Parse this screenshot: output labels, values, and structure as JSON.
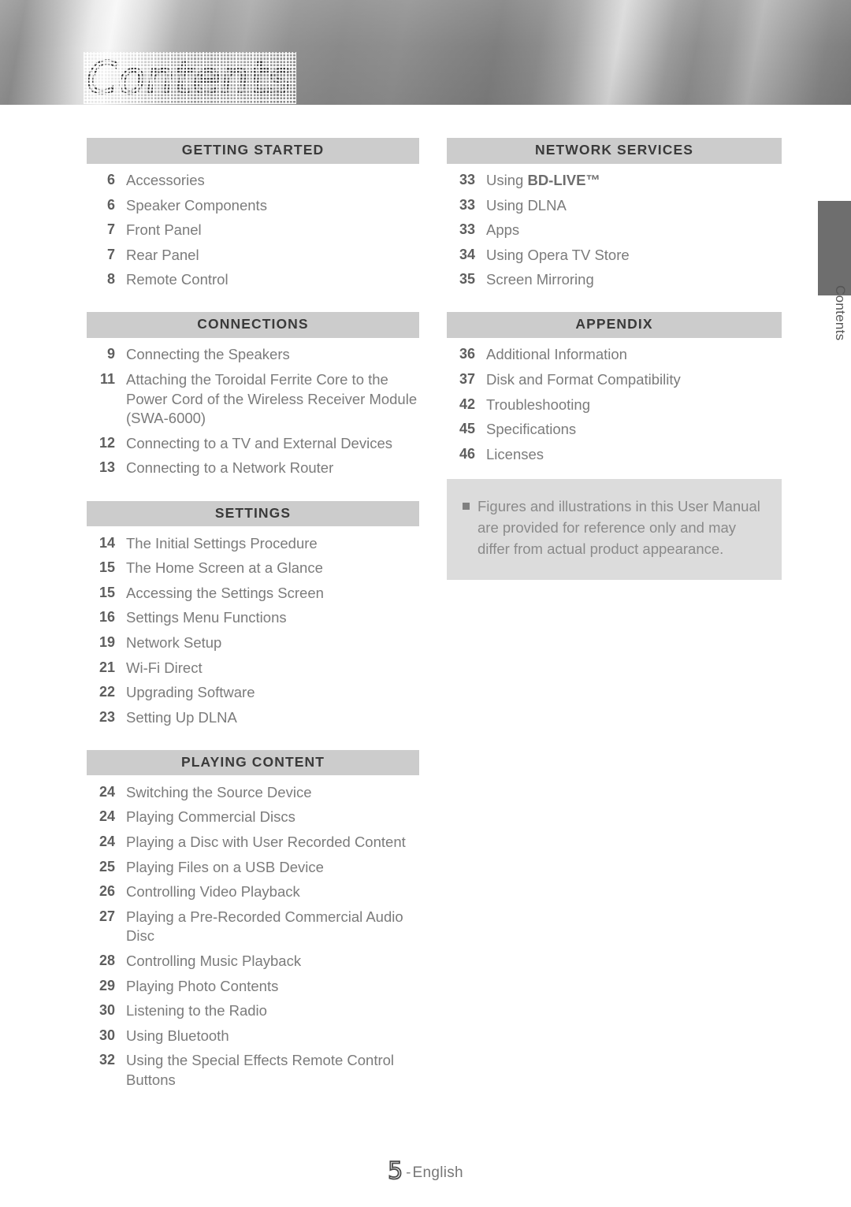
{
  "banner": {
    "title": "Contents"
  },
  "edge_tab": {
    "label": "Contents"
  },
  "columns": {
    "left": [
      {
        "heading": "GETTING STARTED",
        "entries": [
          {
            "page": "6",
            "title": "Accessories"
          },
          {
            "page": "6",
            "title": "Speaker Components"
          },
          {
            "page": "7",
            "title": "Front Panel"
          },
          {
            "page": "7",
            "title": "Rear Panel"
          },
          {
            "page": "8",
            "title": "Remote Control"
          }
        ]
      },
      {
        "heading": "CONNECTIONS",
        "entries": [
          {
            "page": "9",
            "title": "Connecting the Speakers"
          },
          {
            "page": "11",
            "title": "Attaching the Toroidal Ferrite Core to the Power Cord of the Wireless Receiver Module (SWA-6000)"
          },
          {
            "page": "12",
            "title": "Connecting to a TV and External Devices"
          },
          {
            "page": "13",
            "title": "Connecting to a Network Router"
          }
        ]
      },
      {
        "heading": "SETTINGS",
        "entries": [
          {
            "page": "14",
            "title": "The Initial Settings Procedure"
          },
          {
            "page": "15",
            "title": "The Home Screen at a Glance"
          },
          {
            "page": "15",
            "title": "Accessing the Settings Screen"
          },
          {
            "page": "16",
            "title": "Settings Menu Functions"
          },
          {
            "page": "19",
            "title": "Network Setup"
          },
          {
            "page": "21",
            "title": "Wi-Fi Direct"
          },
          {
            "page": "22",
            "title": "Upgrading Software"
          },
          {
            "page": "23",
            "title": "Setting Up DLNA"
          }
        ]
      },
      {
        "heading": "PLAYING CONTENT",
        "entries": [
          {
            "page": "24",
            "title": "Switching the Source Device"
          },
          {
            "page": "24",
            "title": "Playing Commercial Discs"
          },
          {
            "page": "24",
            "title": "Playing a Disc with User Recorded Content"
          },
          {
            "page": "25",
            "title": "Playing Files on a USB Device"
          },
          {
            "page": "26",
            "title": "Controlling Video Playback"
          },
          {
            "page": "27",
            "title": "Playing a Pre-Recorded Commercial Audio Disc"
          },
          {
            "page": "28",
            "title": "Controlling Music Playback"
          },
          {
            "page": "29",
            "title": "Playing Photo Contents"
          },
          {
            "page": "30",
            "title": "Listening to the Radio"
          },
          {
            "page": "30",
            "title": "Using Bluetooth"
          },
          {
            "page": "32",
            "title": "Using the Special Effects Remote Control Buttons"
          }
        ]
      }
    ],
    "right": [
      {
        "heading": "NETWORK SERVICES",
        "entries": [
          {
            "page": "33",
            "title": "Using BD-LIVE™",
            "emph": "BD-LIVE™",
            "prefix": "Using "
          },
          {
            "page": "33",
            "title": "Using DLNA"
          },
          {
            "page": "33",
            "title": "Apps"
          },
          {
            "page": "34",
            "title": "Using Opera TV Store"
          },
          {
            "page": "35",
            "title": "Screen Mirroring"
          }
        ]
      },
      {
        "heading": "APPENDIX",
        "entries": [
          {
            "page": "36",
            "title": "Additional Information"
          },
          {
            "page": "37",
            "title": "Disk and Format Compatibility"
          },
          {
            "page": "42",
            "title": "Troubleshooting"
          },
          {
            "page": "45",
            "title": "Specifications"
          },
          {
            "page": "46",
            "title": "Licenses"
          }
        ]
      }
    ]
  },
  "note": {
    "text": "Figures and illustrations in this User Manual are provided for reference only and may differ from actual product appearance."
  },
  "footer": {
    "page_number": "5",
    "separator": "-",
    "language": "English"
  }
}
